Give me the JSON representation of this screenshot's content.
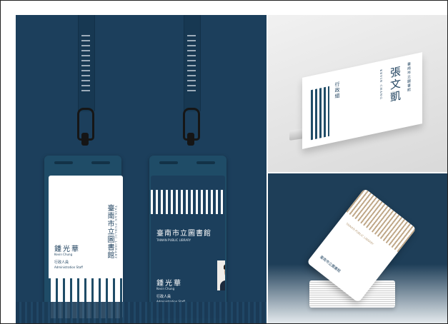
{
  "badge_left": {
    "library_name": "臺南市立圖書館",
    "library_name_en": "TAINAN PUBLIC LIBRARY",
    "person_name": "鍾光華",
    "person_name_en": "Kevin Chung",
    "role": "行政人員",
    "role_en": "Administration Staff"
  },
  "badge_right": {
    "library_name": "臺南市立圖書館",
    "library_name_en": "TAINAN PUBLIC LIBRARY",
    "person_name": "鍾光華",
    "person_name_en": "Kevin Chung",
    "role": "行政人員",
    "role_en": "Administration Staff"
  },
  "desk_plate": {
    "name": "張文凱",
    "title": "行政組",
    "org": "臺南市立圖書館",
    "name_en": "KEVIN CHANG"
  },
  "business_card": {
    "library_name": "臺南市立圖書館",
    "library_name_en": "TAINAN PUBLIC LIBRARY"
  },
  "colors": {
    "navy": "#1c3f5c",
    "holder": "#1f4c67",
    "white": "#ffffff",
    "gold": "#b99f7c"
  }
}
